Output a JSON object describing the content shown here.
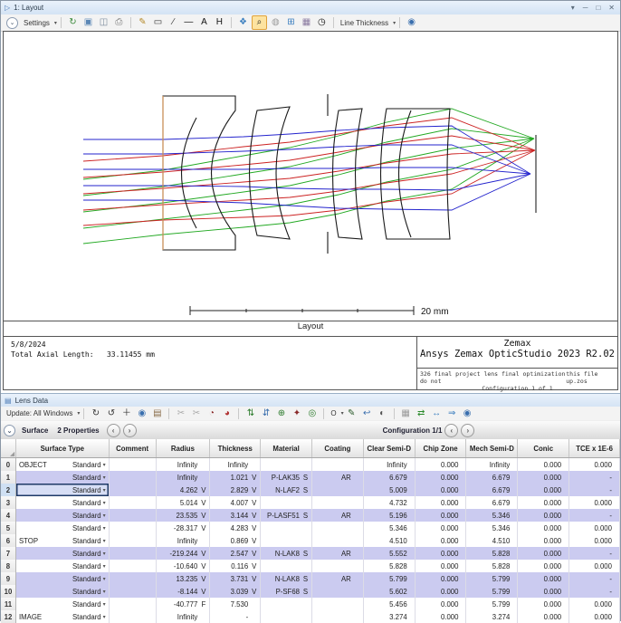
{
  "window": {
    "title": "1: Layout",
    "controls": [
      {
        "name": "window-menu-button",
        "glyph": "▾"
      },
      {
        "name": "minimize-button",
        "glyph": "─"
      },
      {
        "name": "maximize-button",
        "glyph": "□"
      },
      {
        "name": "close-button",
        "glyph": "✕"
      }
    ]
  },
  "layout_toolbar": {
    "items": [
      {
        "kind": "chevlabel",
        "name": "settings-dropdown",
        "label": "Settings"
      },
      {
        "kind": "sep"
      },
      {
        "kind": "icon",
        "name": "refresh-icon",
        "glyph": "↻",
        "color": "#3a8a3a"
      },
      {
        "kind": "icon",
        "name": "copy-window-icon",
        "glyph": "▣",
        "color": "#5b87b5"
      },
      {
        "kind": "icon",
        "name": "save-image-icon",
        "glyph": "◫",
        "color": "#7a8a9a"
      },
      {
        "kind": "icon",
        "name": "print-icon",
        "glyph": "⎙",
        "color": "#777777"
      },
      {
        "kind": "sep"
      },
      {
        "kind": "icon",
        "name": "pencil-icon",
        "glyph": "✎",
        "color": "#b58a2a"
      },
      {
        "kind": "icon",
        "name": "rectangle-tool-icon",
        "glyph": "▭",
        "color": "#333333"
      },
      {
        "kind": "icon",
        "name": "line-arrow-tool-icon",
        "glyph": "∕",
        "color": "#333333"
      },
      {
        "kind": "icon",
        "name": "line-tool-icon",
        "glyph": "—",
        "color": "#111111"
      },
      {
        "kind": "icon",
        "name": "text-tool-icon",
        "glyph": "A",
        "color": "#111111"
      },
      {
        "kind": "icon",
        "name": "height-tool-icon",
        "glyph": "H",
        "color": "#111111"
      },
      {
        "kind": "sep"
      },
      {
        "kind": "icon",
        "name": "pan-icon",
        "glyph": "❖",
        "color": "#3a7ebf"
      },
      {
        "kind": "icon",
        "name": "zoom-icon",
        "glyph": "⌕",
        "color": "#1a1a1a",
        "active": true
      },
      {
        "kind": "icon",
        "name": "lock-icon",
        "glyph": "◍",
        "color": "#9a9a9a"
      },
      {
        "kind": "icon",
        "name": "fit-window-icon",
        "glyph": "⊞",
        "color": "#3a7ebf"
      },
      {
        "kind": "icon",
        "name": "snapshot-icon",
        "glyph": "▦",
        "color": "#8a7aa0"
      },
      {
        "kind": "icon",
        "name": "clock-icon",
        "glyph": "◷",
        "color": "#111111"
      },
      {
        "kind": "sep"
      },
      {
        "kind": "droplabel",
        "name": "line-thickness-dropdown",
        "label": "Line Thickness"
      },
      {
        "kind": "sep"
      },
      {
        "kind": "icon",
        "name": "help-icon",
        "glyph": "◉",
        "color": "#3a6fae"
      }
    ]
  },
  "layout_view": {
    "scale_label": "20 mm",
    "caption": "Layout",
    "date": "5/8/2024",
    "total_axial_length": "Total Axial Length:   33.11455 mm",
    "brand": "Zemax",
    "product": "Ansys Zemax OpticStudio 2023 R2.02",
    "note_left": "326 final project lens final optimization do not",
    "note_right": "this file up.zos",
    "note_config": "Configuration 1 of 1",
    "colors": {
      "ray_blue": "#2323cd",
      "ray_red": "#cc2222",
      "ray_green": "#23a923",
      "lens_outline": "#1a1a1a",
      "object_line": "#d4955a"
    }
  },
  "lens_data": {
    "title": "Lens Data",
    "toolbar": {
      "items": [
        {
          "kind": "droplabel",
          "name": "update-dropdown",
          "label": "Update: All Windows"
        },
        {
          "kind": "sep"
        },
        {
          "kind": "icon",
          "name": "rotate-cw-icon",
          "glyph": "↻",
          "color": "#333333"
        },
        {
          "kind": "icon",
          "name": "rotate-ccw-icon",
          "glyph": "↺",
          "color": "#333333"
        },
        {
          "kind": "icon",
          "name": "crosshair-icon",
          "glyph": "＋",
          "color": "#333333"
        },
        {
          "kind": "icon",
          "name": "globe-icon",
          "glyph": "◉",
          "color": "#3a6fae"
        },
        {
          "kind": "icon",
          "name": "catalog-icon",
          "glyph": "▤",
          "color": "#8a6d4a"
        },
        {
          "kind": "sep"
        },
        {
          "kind": "icon",
          "name": "cut-icon",
          "glyph": "✂",
          "color": "#aaaaaa"
        },
        {
          "kind": "icon",
          "name": "cut-paste-icon",
          "glyph": "✂",
          "color": "#aaaaaa"
        },
        {
          "kind": "icon",
          "name": "goggles-icon",
          "glyph": "◔",
          "color": "#8a2a2a"
        },
        {
          "kind": "icon",
          "name": "goggles-add-icon",
          "glyph": "◕",
          "color": "#b03030"
        },
        {
          "kind": "sep"
        },
        {
          "kind": "icon",
          "name": "swap-rows-icon",
          "glyph": "⇅",
          "color": "#2a7a2a"
        },
        {
          "kind": "icon",
          "name": "move-down-icon",
          "glyph": "⇵",
          "color": "#3a6fae"
        },
        {
          "kind": "icon",
          "name": "aperture-icon",
          "glyph": "⊕",
          "color": "#2a7a2a"
        },
        {
          "kind": "icon",
          "name": "stop-surface-icon",
          "glyph": "✦",
          "color": "#8a2a2a"
        },
        {
          "kind": "icon",
          "name": "globe-settings-icon",
          "glyph": "◎",
          "color": "#2a7a2a"
        },
        {
          "kind": "sep"
        },
        {
          "kind": "droplabel",
          "name": "circle-tool-dropdown",
          "label": "O"
        },
        {
          "kind": "icon",
          "name": "solve-pencil-icon",
          "glyph": "✎",
          "color": "#2a5a2a"
        },
        {
          "kind": "icon",
          "name": "undo-icon",
          "glyph": "↩",
          "color": "#3a6fae"
        },
        {
          "kind": "icon",
          "name": "view-toggle-icon",
          "glyph": "◐",
          "color": "#555555"
        },
        {
          "kind": "sep"
        },
        {
          "kind": "icon",
          "name": "grid-icon",
          "glyph": "▦",
          "color": "#9a9a9a"
        },
        {
          "kind": "icon",
          "name": "sync-icon",
          "glyph": "⇄",
          "color": "#2a8a2a"
        },
        {
          "kind": "icon",
          "name": "nav-lr-icon",
          "glyph": "↔",
          "color": "#3a7ebf"
        },
        {
          "kind": "icon",
          "name": "go-next-icon",
          "glyph": "⇒",
          "color": "#3a7ebf"
        },
        {
          "kind": "icon",
          "name": "help-icon",
          "glyph": "◉",
          "color": "#3a6fae"
        }
      ]
    },
    "props_bar": {
      "surface_label": "Surface",
      "properties_label": "2 Properties",
      "config_label": "Configuration 1/1"
    },
    "table": {
      "headers": [
        "",
        "Surface Type",
        "Comment",
        "Radius",
        "Thickness",
        "Material",
        "Coating",
        "Clear Semi-D",
        "Chip Zone",
        "Mech Semi-D",
        "Conic",
        "TCE x 1E-6"
      ],
      "type_label": "Standard",
      "rows": [
        {
          "n": "0",
          "label": "OBJECT",
          "type": "Standard",
          "comment": "",
          "radius": "Infinity",
          "rs": "",
          "thick": "Infinity",
          "ths": "",
          "mat": "",
          "ms": "",
          "coat": "",
          "clear": "Infinity",
          "chip": "0.000",
          "mech": "Infinity",
          "conic": "0.000",
          "tce": "0.000",
          "hl": false,
          "sel": false
        },
        {
          "n": "1",
          "label": "",
          "type": "Standard",
          "comment": "",
          "radius": "Infinity",
          "rs": "",
          "thick": "1.021",
          "ths": "V",
          "mat": "P-LAK35",
          "ms": "S",
          "coat": "AR",
          "clear": "6.679",
          "chip": "0.000",
          "mech": "6.679",
          "conic": "0.000",
          "tce": "-",
          "hl": true,
          "sel": false
        },
        {
          "n": "2",
          "label": "",
          "type": "Standard",
          "comment": "",
          "radius": "4.262",
          "rs": "V",
          "thick": "2.829",
          "ths": "V",
          "mat": "N-LAF2",
          "ms": "S",
          "coat": "",
          "clear": "5.009",
          "chip": "0.000",
          "mech": "6.679",
          "conic": "0.000",
          "tce": "-",
          "hl": true,
          "sel": true
        },
        {
          "n": "3",
          "label": "",
          "type": "Standard",
          "comment": "",
          "radius": "5.014",
          "rs": "V",
          "thick": "4.007",
          "ths": "V",
          "mat": "",
          "ms": "",
          "coat": "",
          "clear": "4.732",
          "chip": "0.000",
          "mech": "6.679",
          "conic": "0.000",
          "tce": "0.000",
          "hl": false,
          "sel": false
        },
        {
          "n": "4",
          "label": "",
          "type": "Standard",
          "comment": "",
          "radius": "23.535",
          "rs": "V",
          "thick": "3.144",
          "ths": "V",
          "mat": "P-LASF51",
          "ms": "S",
          "coat": "AR",
          "clear": "5.196",
          "chip": "0.000",
          "mech": "5.346",
          "conic": "0.000",
          "tce": "-",
          "hl": true,
          "sel": false
        },
        {
          "n": "5",
          "label": "",
          "type": "Standard",
          "comment": "",
          "radius": "-28.317",
          "rs": "V",
          "thick": "4.283",
          "ths": "V",
          "mat": "",
          "ms": "",
          "coat": "",
          "clear": "5.346",
          "chip": "0.000",
          "mech": "5.346",
          "conic": "0.000",
          "tce": "0.000",
          "hl": false,
          "sel": false
        },
        {
          "n": "6",
          "label": "STOP",
          "type": "Standard",
          "comment": "",
          "radius": "Infinity",
          "rs": "",
          "thick": "0.869",
          "ths": "V",
          "mat": "",
          "ms": "",
          "coat": "",
          "clear": "4.510",
          "chip": "0.000",
          "mech": "4.510",
          "conic": "0.000",
          "tce": "0.000",
          "hl": false,
          "sel": false
        },
        {
          "n": "7",
          "label": "",
          "type": "Standard",
          "comment": "",
          "radius": "-219.244",
          "rs": "V",
          "thick": "2.547",
          "ths": "V",
          "mat": "N-LAK8",
          "ms": "S",
          "coat": "AR",
          "clear": "5.552",
          "chip": "0.000",
          "mech": "5.828",
          "conic": "0.000",
          "tce": "-",
          "hl": true,
          "sel": false
        },
        {
          "n": "8",
          "label": "",
          "type": "Standard",
          "comment": "",
          "radius": "-10.640",
          "rs": "V",
          "thick": "0.116",
          "ths": "V",
          "mat": "",
          "ms": "",
          "coat": "",
          "clear": "5.828",
          "chip": "0.000",
          "mech": "5.828",
          "conic": "0.000",
          "tce": "0.000",
          "hl": false,
          "sel": false
        },
        {
          "n": "9",
          "label": "",
          "type": "Standard",
          "comment": "",
          "radius": "13.235",
          "rs": "V",
          "thick": "3.731",
          "ths": "V",
          "mat": "N-LAK8",
          "ms": "S",
          "coat": "AR",
          "clear": "5.799",
          "chip": "0.000",
          "mech": "5.799",
          "conic": "0.000",
          "tce": "-",
          "hl": true,
          "sel": false
        },
        {
          "n": "10",
          "label": "",
          "type": "Standard",
          "comment": "",
          "radius": "-8.144",
          "rs": "V",
          "thick": "3.039",
          "ths": "V",
          "mat": "P-SF68",
          "ms": "S",
          "coat": "",
          "clear": "5.602",
          "chip": "0.000",
          "mech": "5.799",
          "conic": "0.000",
          "tce": "-",
          "hl": true,
          "sel": false
        },
        {
          "n": "11",
          "label": "",
          "type": "Standard",
          "comment": "",
          "radius": "-40.777",
          "rs": "F",
          "thick": "7.530",
          "ths": "",
          "mat": "",
          "ms": "",
          "coat": "",
          "clear": "5.456",
          "chip": "0.000",
          "mech": "5.799",
          "conic": "0.000",
          "tce": "0.000",
          "hl": false,
          "sel": false
        },
        {
          "n": "12",
          "label": "IMAGE",
          "type": "Standard",
          "comment": "",
          "radius": "Infinity",
          "rs": "",
          "thick": "-",
          "ths": "",
          "mat": "",
          "ms": "",
          "coat": "",
          "clear": "3.274",
          "chip": "0.000",
          "mech": "3.274",
          "conic": "0.000",
          "tce": "0.000",
          "hl": false,
          "sel": false
        }
      ]
    }
  }
}
